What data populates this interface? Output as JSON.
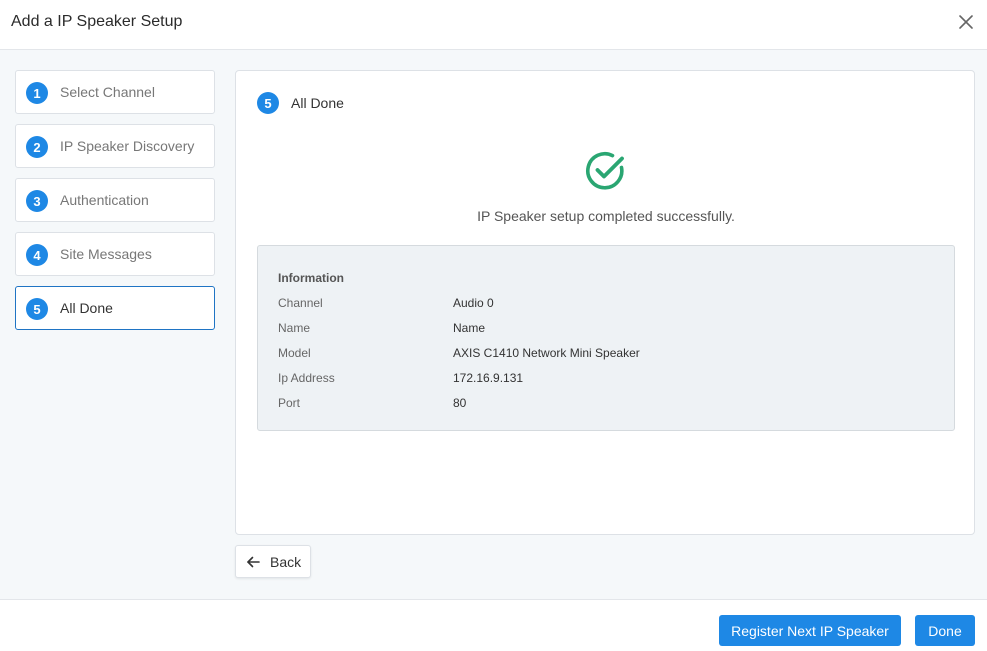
{
  "dialog": {
    "title": "Add a IP Speaker Setup",
    "close_icon": "close-icon"
  },
  "steps": [
    {
      "number": "1",
      "label": "Select Channel",
      "active": false
    },
    {
      "number": "2",
      "label": "IP Speaker Discovery",
      "active": false
    },
    {
      "number": "3",
      "label": "Authentication",
      "active": false
    },
    {
      "number": "4",
      "label": "Site Messages",
      "active": false
    },
    {
      "number": "5",
      "label": "All Done",
      "active": true
    }
  ],
  "panel": {
    "step_number": "5",
    "title": "All Done",
    "success_icon": "check-circle-icon",
    "success_color": "#2aa672",
    "message": "IP Speaker setup completed successfully.",
    "info": {
      "heading": "Information",
      "rows": [
        {
          "label": "Channel",
          "value": "Audio 0"
        },
        {
          "label": "Name",
          "value": "Name"
        },
        {
          "label": "Model",
          "value": "AXIS C1410 Network Mini Speaker"
        },
        {
          "label": "Ip Address",
          "value": "172.16.9.131"
        },
        {
          "label": "Port",
          "value": "80"
        }
      ]
    }
  },
  "actions": {
    "back_label": "Back",
    "back_icon": "arrow-left-icon",
    "register_next_label": "Register Next IP Speaker",
    "done_label": "Done"
  },
  "colors": {
    "accent": "#1e88e5",
    "active_border": "#1f74c4"
  }
}
